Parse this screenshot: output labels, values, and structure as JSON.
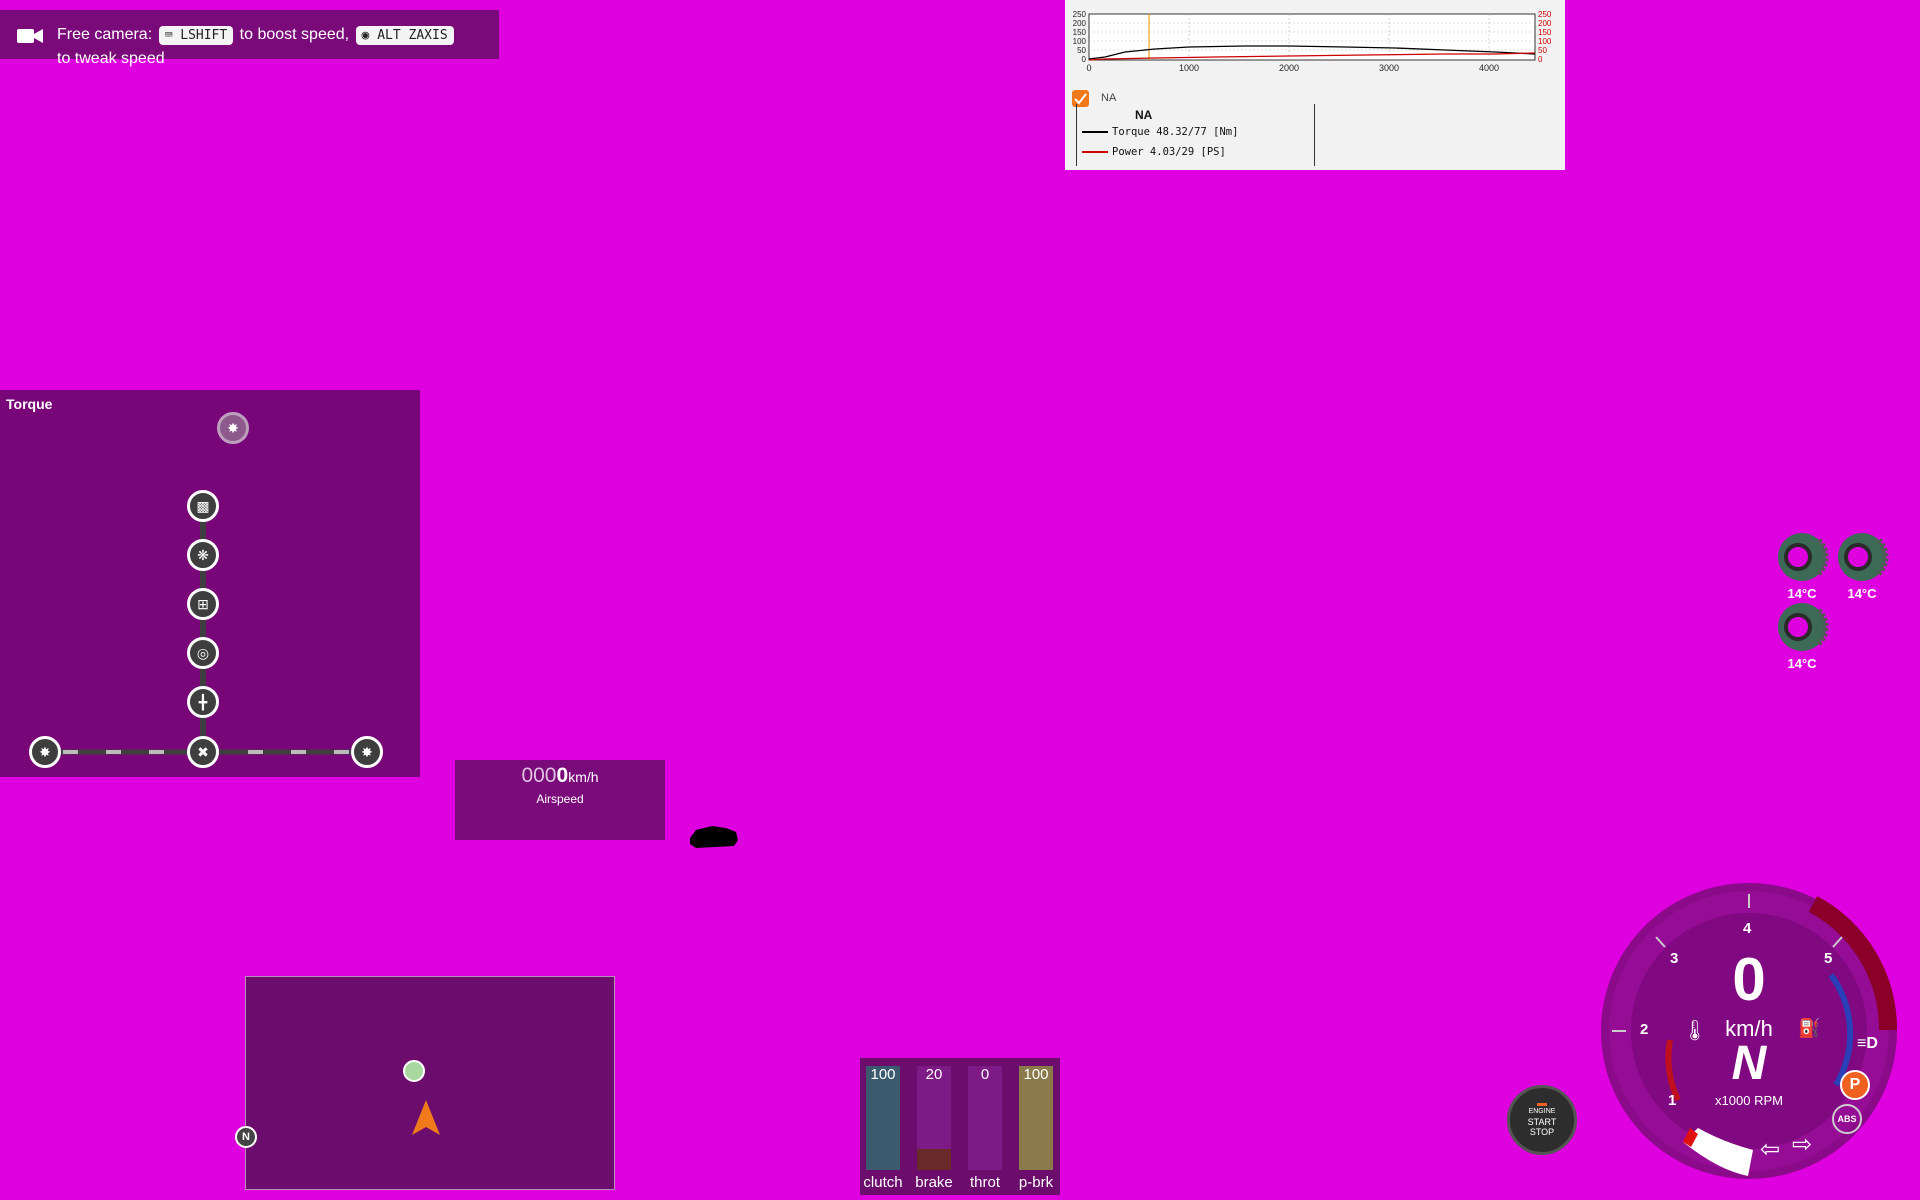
{
  "camera_hint": {
    "prefix": "Free camera:",
    "key1": "LSHIFT",
    "mid": "to boost speed,",
    "key2": "ALT ZAXIS",
    "suffix": "to tweak speed"
  },
  "graph": {
    "checkbox_label": "NA",
    "legend_title": "NA",
    "y_ticks_left": [
      "250",
      "200",
      "150",
      "100",
      "50",
      "0"
    ],
    "y_ticks_right": [
      "250",
      "200",
      "150",
      "100",
      "50",
      "0"
    ],
    "x_ticks": [
      "0",
      "1000",
      "2000",
      "3000",
      "4000"
    ],
    "torque_row": "Torque 48.32/77 [Nm]",
    "power_row": "Power  4.03/29  [PS]",
    "colors": {
      "torque": "#000000",
      "power": "#cc0000",
      "cursor": "#f0a020"
    }
  },
  "torque_panel": {
    "title": "Torque"
  },
  "airspeed": {
    "digits_dim": "000",
    "digits_bright": "0",
    "unit": "km/h",
    "label": "Airspeed"
  },
  "minimap": {
    "north": "N"
  },
  "pedals": {
    "items": [
      {
        "label": "clutch",
        "value": "100",
        "fill": 1.0,
        "color": "#3b5a6e"
      },
      {
        "label": "brake",
        "value": "20",
        "fill": 0.2,
        "color": "#6b2a2a"
      },
      {
        "label": "throt",
        "value": "0",
        "fill": 0.0,
        "color": "#3a6a3a"
      },
      {
        "label": "p-brk",
        "value": "100",
        "fill": 1.0,
        "color": "#8a7a4a"
      }
    ]
  },
  "tyres": [
    {
      "temp": "14°C"
    },
    {
      "temp": "14°C"
    },
    {
      "temp": "14°C"
    }
  ],
  "dashboard": {
    "speed": "0",
    "speed_unit": "km/h",
    "gear": "N",
    "rpm_label": "x1000 RPM",
    "ticks": [
      "1",
      "2",
      "3",
      "4",
      "5"
    ],
    "park": "P",
    "abs": "ABS"
  },
  "engine_button": {
    "line1": "ENGINE",
    "line2": "START",
    "line3": "STOP"
  }
}
